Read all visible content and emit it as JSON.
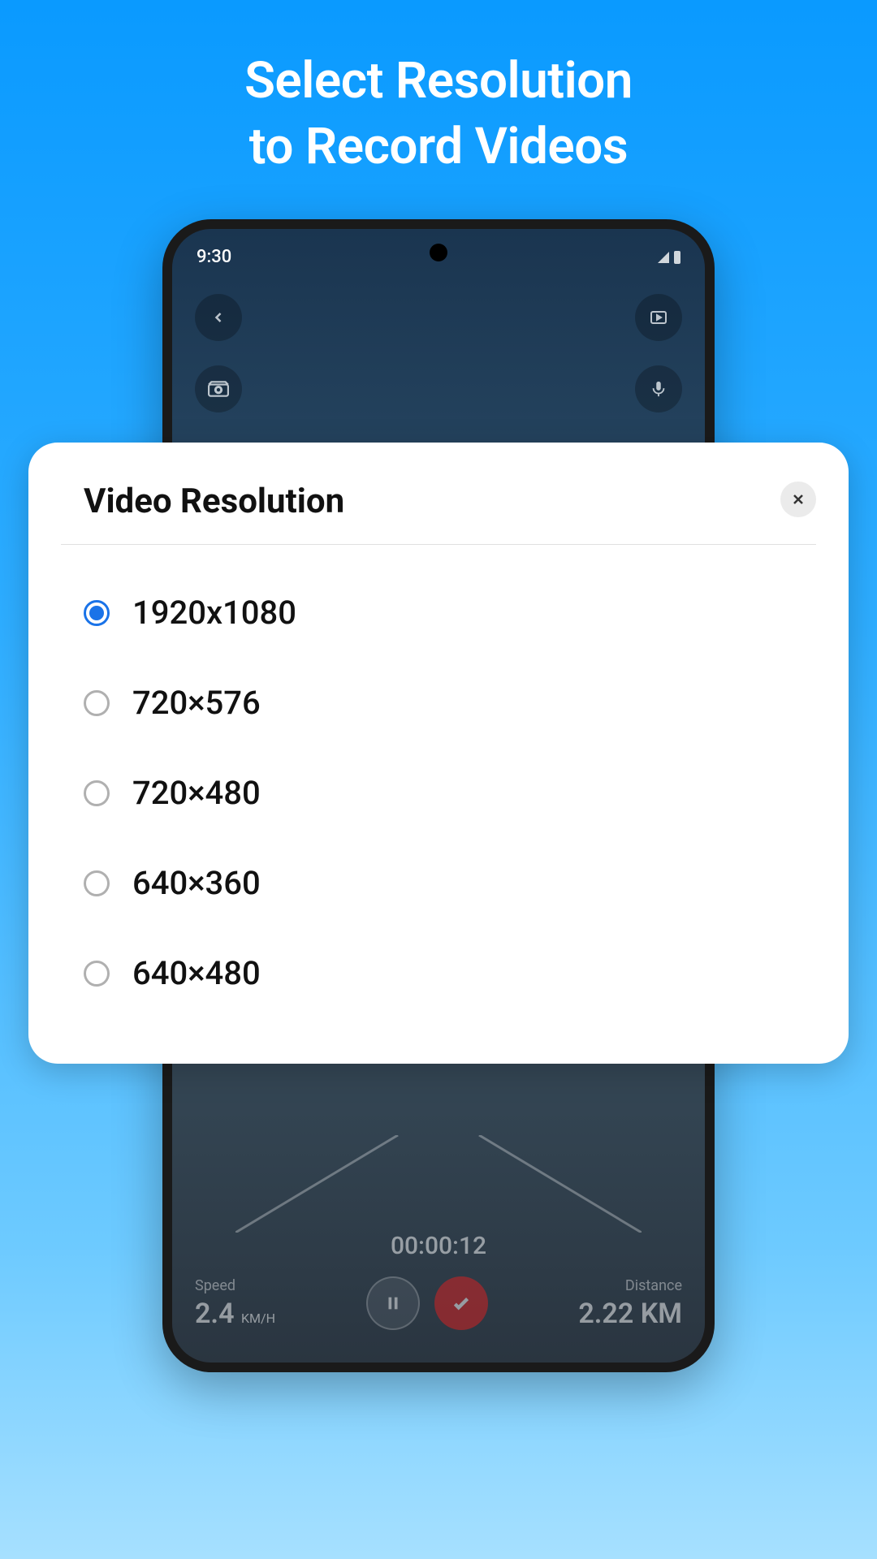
{
  "hero": {
    "line1": "Select Resolution",
    "line2": "to Record Videos"
  },
  "status": {
    "time": "9:30"
  },
  "modal": {
    "title": "Video Resolution",
    "options": [
      {
        "label": "1920x1080",
        "selected": true
      },
      {
        "label": "720×576",
        "selected": false
      },
      {
        "label": "720×480",
        "selected": false
      },
      {
        "label": "640×360",
        "selected": false
      },
      {
        "label": "640×480",
        "selected": false
      }
    ]
  },
  "hud": {
    "timer": "00:00:12",
    "speed_label": "Speed",
    "speed_value": "2.4",
    "speed_unit": "KM/H",
    "distance_label": "Distance",
    "distance_value": "2.22 KM"
  },
  "icons": {
    "back": "back-icon",
    "gallery": "gallery-icon",
    "camera_switch": "camera-switch-icon",
    "mic": "mic-icon",
    "close": "close-icon",
    "pause": "pause-icon",
    "check": "check-icon"
  }
}
